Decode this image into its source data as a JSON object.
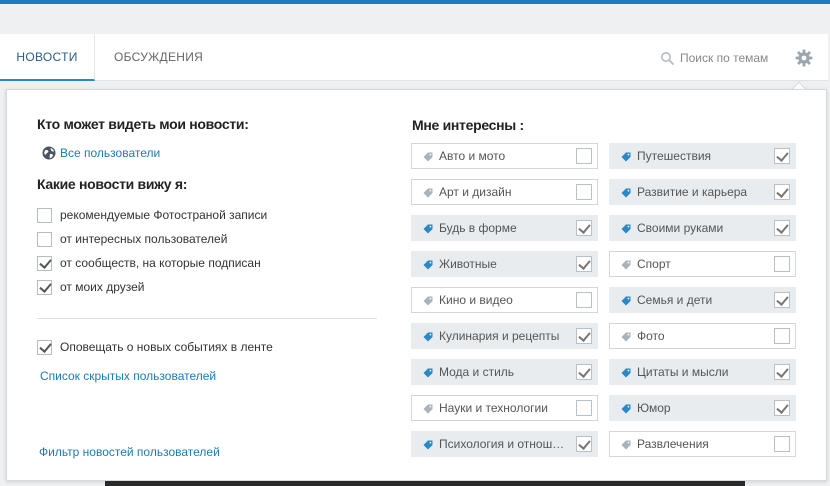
{
  "tabs": {
    "news": "НОВОСТИ",
    "discussions": "ОБСУЖДЕНИЯ"
  },
  "search": {
    "placeholder": "Поиск по темам"
  },
  "settings": {
    "visibility_title": "Кто может видеть мои новости:",
    "visibility_value": "Все пользователи",
    "which_news_title": "Какие новости вижу я:",
    "options": [
      {
        "label": "рекомендуемые Фотостраной записи",
        "checked": false
      },
      {
        "label": "от интересных пользователей",
        "checked": false
      },
      {
        "label": "от сообществ, на которые подписан",
        "checked": true
      },
      {
        "label": "от моих друзей",
        "checked": true
      }
    ],
    "notify": {
      "label": "Оповещать о новых событиях в ленте",
      "checked": true
    },
    "hidden_users_link": "Список скрытых пользователей",
    "filter_link": "Фильтр новостей пользователей"
  },
  "interests": {
    "title": "Мне интересны :",
    "items": [
      {
        "label": "Авто и мото",
        "checked": false
      },
      {
        "label": "Путешествия",
        "checked": true
      },
      {
        "label": "Арт и дизайн",
        "checked": false
      },
      {
        "label": "Развитие и карьера",
        "checked": true
      },
      {
        "label": "Будь в форме",
        "checked": true
      },
      {
        "label": "Своими руками",
        "checked": true
      },
      {
        "label": "Животные",
        "checked": true
      },
      {
        "label": "Спорт",
        "checked": false
      },
      {
        "label": "Кино и видео",
        "checked": false
      },
      {
        "label": "Семья и дети",
        "checked": true
      },
      {
        "label": "Кулинария и рецепты",
        "checked": true
      },
      {
        "label": "Фото",
        "checked": false
      },
      {
        "label": "Мода и стиль",
        "checked": true
      },
      {
        "label": "Цитаты и мысли",
        "checked": true
      },
      {
        "label": "Науки и технологии",
        "checked": false
      },
      {
        "label": "Юмор",
        "checked": true
      },
      {
        "label": "Психология и отнош…",
        "checked": true
      },
      {
        "label": "Развлечения",
        "checked": false
      }
    ]
  },
  "colors": {
    "accent": "#1f7ac4",
    "link": "#1d79b8",
    "tag_on": "#2a87c8",
    "tag_off": "#aab3ba"
  }
}
